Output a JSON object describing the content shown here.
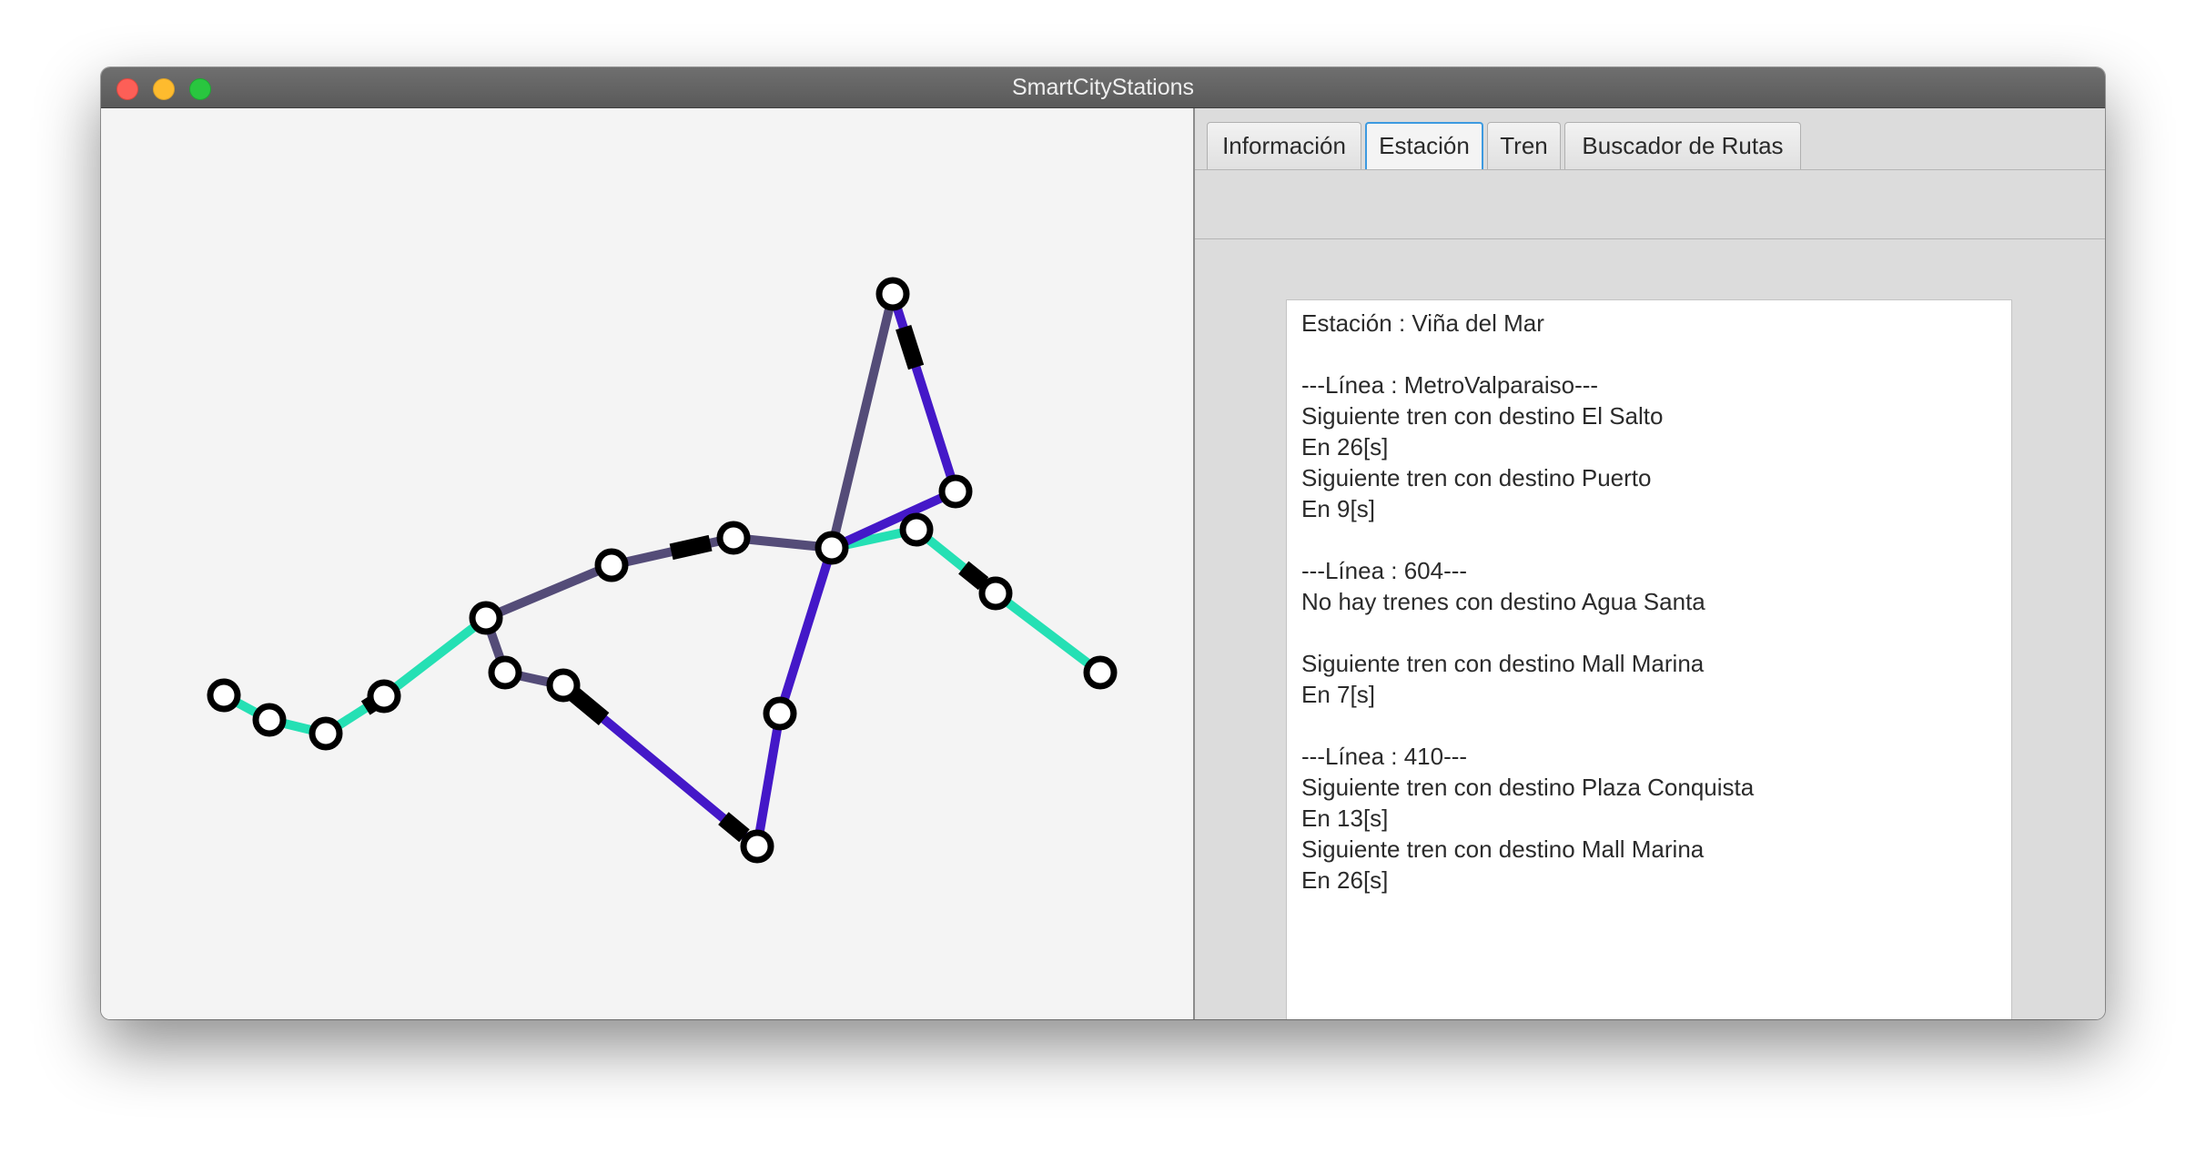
{
  "window": {
    "title": "SmartCityStations"
  },
  "tabs": [
    {
      "label": "Información",
      "selected": false
    },
    {
      "label": "Estación",
      "selected": true
    },
    {
      "label": "Tren",
      "selected": false
    },
    {
      "label": "Buscador de Rutas",
      "selected": false
    }
  ],
  "station_info": {
    "lines": [
      "Estación : Viña del Mar",
      "",
      "---Línea : MetroValparaiso---",
      "Siguiente tren con destino El Salto",
      "En 26[s]",
      "Siguiente tren con destino Puerto",
      "En 9[s]",
      "",
      "---Línea : 604---",
      "No hay trenes con destino Agua Santa",
      "",
      "Siguiente tren con destino Mall Marina",
      "En 7[s]",
      "",
      "---Línea : 410---",
      "Siguiente tren con destino Plaza Conquista",
      "En 13[s]",
      "Siguiente tren con destino Mall Marina",
      "En 26[s]"
    ]
  },
  "map": {
    "colors": {
      "teal_line": "#25e0b4",
      "slate_line": "#544c78",
      "purple_line": "#4418c8",
      "train": "#000000",
      "station_fill": "#ffffff",
      "station_stroke": "#000000"
    }
  }
}
